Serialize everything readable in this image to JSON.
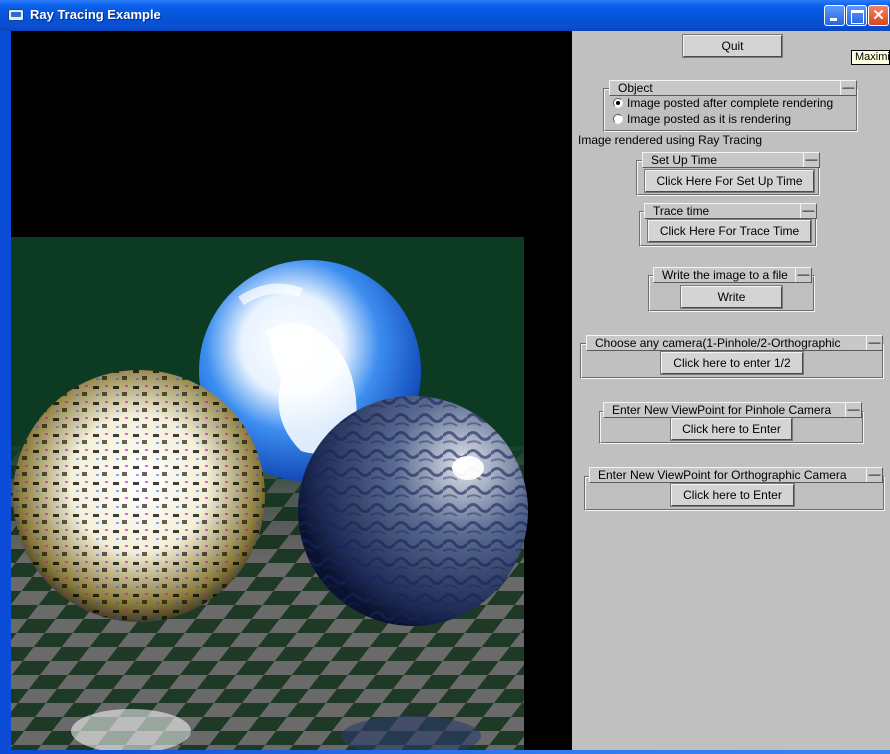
{
  "window": {
    "title": "Ray Tracing Example",
    "tooltip": "Maximize",
    "controls": [
      "minimize-icon",
      "maximize-icon",
      "close-icon"
    ]
  },
  "panel": {
    "quit_label": "Quit",
    "object_group": {
      "title": "Object",
      "collapse_glyph": "—",
      "options": [
        {
          "label": "Image posted after complete rendering",
          "selected": true
        },
        {
          "label": "Image posted as it is rendering",
          "selected": false
        }
      ]
    },
    "status_text": "Image rendered using Ray Tracing",
    "setup_group": {
      "title": "Set Up Time",
      "collapse_glyph": "—",
      "button": "Click Here For Set Up Time"
    },
    "trace_group": {
      "title": "Trace time",
      "collapse_glyph": "—",
      "button": "Click Here For Trace Time"
    },
    "write_group": {
      "title": "Write the image to a file",
      "collapse_glyph": "—",
      "button": "Write"
    },
    "camera_group": {
      "title": "Choose any camera(1-Pinhole/2-Orthographic",
      "collapse_glyph": "—",
      "button": "Click here to enter 1/2"
    },
    "pinhole_group": {
      "title": "Enter New ViewPoint for Pinhole Camera",
      "collapse_glyph": "—",
      "button": "Click here to Enter"
    },
    "ortho_group": {
      "title": "Enter New ViewPoint for Orthographic Camera",
      "collapse_glyph": "—",
      "button": "Click here to Enter"
    }
  },
  "render": {
    "background_color": "#000000",
    "wall_color": "#0d3a22",
    "floor_light": "#6a6a6a",
    "floor_dark": "#1e3a26",
    "spheres": [
      "earth-texture",
      "cloud-texture",
      "marble-texture"
    ]
  }
}
